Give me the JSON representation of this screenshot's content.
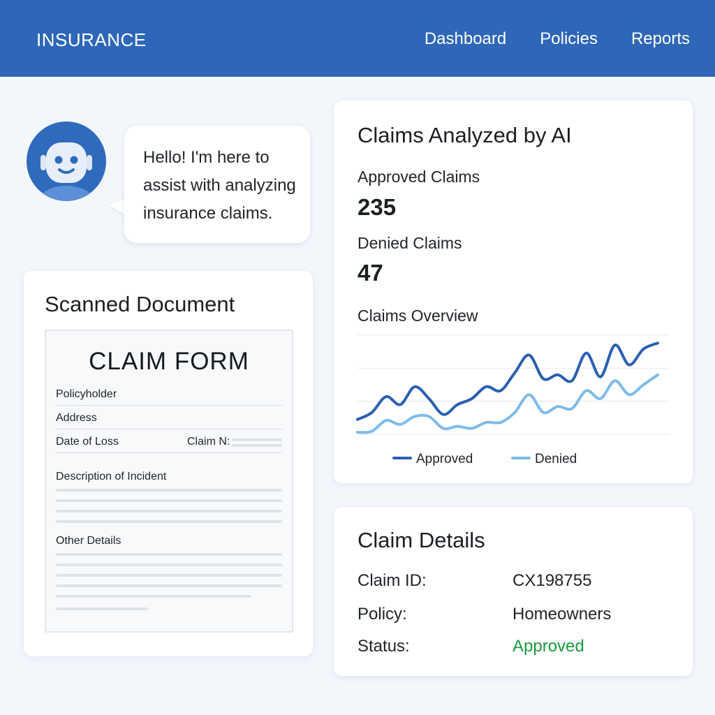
{
  "header": {
    "brand": "INSURANCE",
    "nav": [
      "Dashboard",
      "Policies",
      "Reports"
    ]
  },
  "assistant": {
    "message_lines": [
      "Hello! I'm here to",
      "assist with analyzing",
      "insurance claims."
    ]
  },
  "scanned_document": {
    "title": "Scanned Document",
    "form_title": "CLAIM FORM",
    "fields": {
      "policyholder": "Policyholder",
      "address": "Address",
      "date_of_loss": "Date of Loss",
      "claim_no": "Claim N:",
      "description": "Description of Incident",
      "other": "Other Details"
    }
  },
  "stats": {
    "title": "Claims Analyzed by AI",
    "approved_label": "Approved Claims",
    "approved_value": "235",
    "denied_label": "Denied Claims",
    "denied_value": "47",
    "chart_title": "Claims Overview"
  },
  "chart_data": {
    "type": "line",
    "title": "Claims Overview",
    "x": [
      1,
      2,
      3,
      4,
      5,
      6,
      7,
      8,
      9,
      10,
      11,
      12,
      13,
      14,
      15,
      16,
      17,
      18,
      19,
      20,
      21,
      22
    ],
    "ylim": [
      0,
      100
    ],
    "grid": true,
    "legend": "bottom",
    "series": [
      {
        "name": "Approved",
        "color": "#2b5fb0",
        "values": [
          15,
          22,
          38,
          30,
          48,
          36,
          20,
          30,
          36,
          48,
          44,
          62,
          80,
          56,
          60,
          54,
          82,
          58,
          90,
          70,
          86,
          92
        ]
      },
      {
        "name": "Denied",
        "color": "#7fbbea",
        "values": [
          2,
          3,
          14,
          10,
          18,
          18,
          6,
          8,
          6,
          12,
          12,
          22,
          40,
          22,
          28,
          26,
          44,
          36,
          54,
          40,
          50,
          60
        ]
      }
    ]
  },
  "details": {
    "title": "Claim Details",
    "rows": [
      {
        "label": "Claim ID:",
        "value": "CX198755"
      },
      {
        "label": "Policy:",
        "value": "Homeowners"
      },
      {
        "label": "Status:",
        "value": "Approved"
      }
    ],
    "status_color": "#1b9a3e"
  }
}
